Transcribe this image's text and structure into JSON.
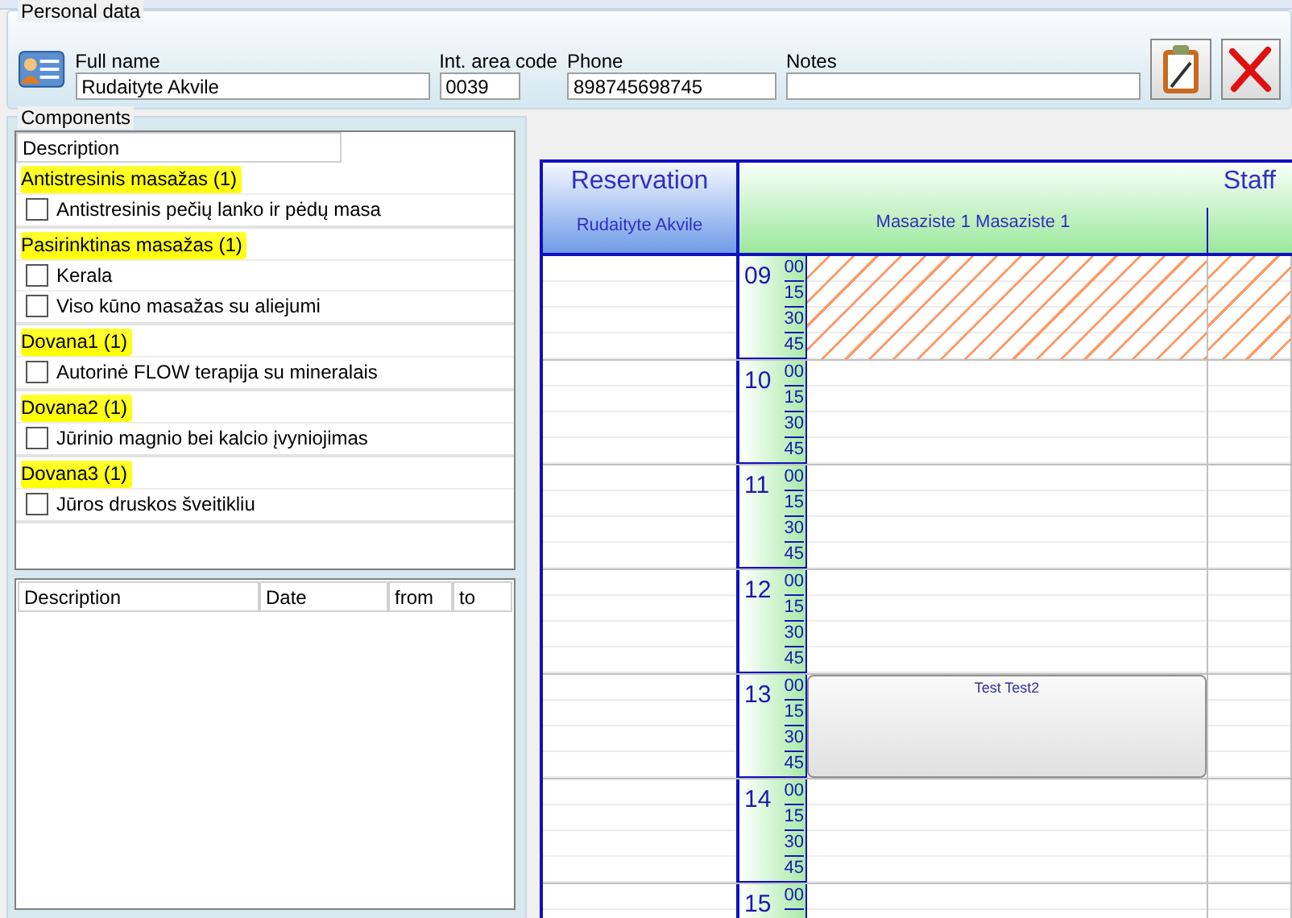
{
  "personal_data": {
    "title": "Personal data",
    "fields": [
      {
        "label": "Full name",
        "value": "Rudaityte Akvile",
        "kind": "name"
      },
      {
        "label": "Int. area code",
        "value": "0039",
        "kind": "code"
      },
      {
        "label": "Phone",
        "value": "898745698745",
        "kind": "phone"
      },
      {
        "label": "Notes",
        "kind": "notes"
      }
    ]
  },
  "components": {
    "title": "Components",
    "header": "Description",
    "groups": [
      {
        "label": "Antistresinis masažas",
        "count": "(1)",
        "highlighted": true,
        "items": [
          {
            "label": "Antistresinis pečių lanko ir pėdų masa",
            "checked": false
          }
        ]
      },
      {
        "label": "Pasirinktinas masažas",
        "count": "(1)",
        "highlighted": true,
        "items": [
          {
            "label": "Kerala",
            "checked": false
          },
          {
            "label": "Viso kūno masažas su aliejumi",
            "checked": false
          }
        ]
      },
      {
        "label": "Dovana1",
        "count": "(1)",
        "highlighted": true,
        "items": [
          {
            "label": "Autorinė FLOW terapija su mineralais",
            "checked": false
          }
        ]
      },
      {
        "label": "Dovana2",
        "count": "(1)",
        "highlighted": true,
        "items": [
          {
            "label": "Jūrinio magnio bei kalcio įvyniojimas",
            "checked": false
          }
        ]
      },
      {
        "label": "Dovana3",
        "count": "(1)",
        "highlighted": true,
        "items": [
          {
            "label": "Jūros druskos šveitikliu",
            "checked": false
          }
        ]
      }
    ]
  },
  "bookings_table": {
    "columns": [
      "Description",
      "Date",
      "from",
      "to"
    ]
  },
  "schedule": {
    "reservation_title": "Reservation",
    "client": "Rudaityte Akvile",
    "staff_title": "Staff",
    "staff": [
      "Masaziste 1 Masaziste 1"
    ],
    "hours": [
      {
        "hour": "09",
        "minutes": [
          "00",
          "15",
          "30",
          "45"
        ],
        "blocked": true
      },
      {
        "hour": "10",
        "minutes": [
          "00",
          "15",
          "30",
          "45"
        ],
        "blocked": false
      },
      {
        "hour": "11",
        "minutes": [
          "00",
          "15",
          "30",
          "45"
        ],
        "blocked": false
      },
      {
        "hour": "12",
        "minutes": [
          "00",
          "15",
          "30",
          "45"
        ],
        "blocked": false
      },
      {
        "hour": "13",
        "minutes": [
          "00",
          "15",
          "30",
          "45"
        ],
        "blocked": false,
        "appointment": "Test Test2"
      },
      {
        "hour": "14",
        "minutes": [
          "00",
          "15",
          "30",
          "45"
        ],
        "blocked": false
      },
      {
        "hour": "15",
        "minutes": [
          "00"
        ],
        "blocked": false
      }
    ]
  }
}
